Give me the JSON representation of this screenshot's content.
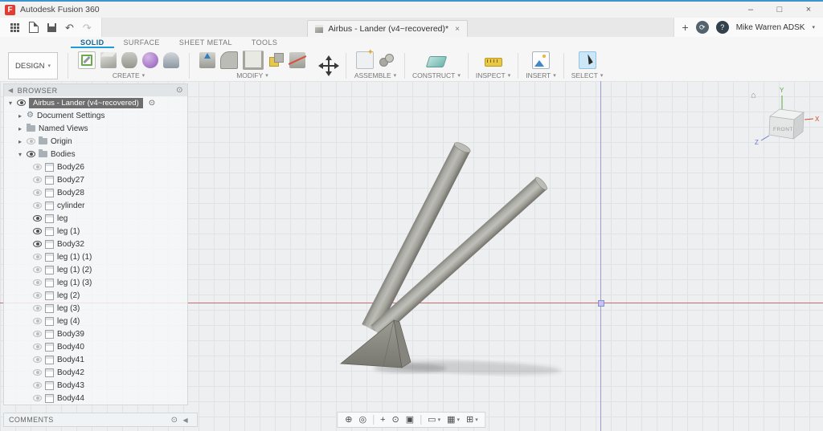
{
  "glyphs": {
    "caret_down": "▾",
    "arrow_collapsed": "▸",
    "arrow_expanded": "▾",
    "chevron_left": "◀",
    "dot_toggle": "⊙"
  },
  "titlebar": {
    "logo": "F",
    "title": "Autodesk Fusion 360",
    "minimize": "–",
    "maximize": "□",
    "close": "×"
  },
  "appbar": {
    "undo": "↶",
    "redo": "↷",
    "tab_title": "Airbus - Lander (v4~recovered)*",
    "tab_close": "×",
    "new_tab": "+",
    "status_glyph": "⟳",
    "help_glyph": "?",
    "user": "Mike Warren ADSK"
  },
  "ribbon": {
    "design": "DESIGN",
    "tabs": [
      {
        "label": "SOLID",
        "active": true
      },
      {
        "label": "SURFACE"
      },
      {
        "label": "SHEET METAL"
      },
      {
        "label": "TOOLS"
      }
    ],
    "groups": [
      "CREATE",
      "MODIFY",
      "ASSEMBLE",
      "CONSTRUCT",
      "INSPECT",
      "INSERT",
      "SELECT"
    ]
  },
  "browser": {
    "title": "BROWSER",
    "root": "Airbus - Lander (v4~recovered)",
    "folders": [
      {
        "label": "Document Settings"
      },
      {
        "label": "Named Views"
      },
      {
        "label": "Origin"
      },
      {
        "label": "Bodies"
      }
    ],
    "bodies": [
      {
        "label": "Body26",
        "visible": false
      },
      {
        "label": "Body27",
        "visible": false
      },
      {
        "label": "Body28",
        "visible": false
      },
      {
        "label": "cylinder",
        "visible": false
      },
      {
        "label": "leg",
        "visible": true
      },
      {
        "label": "leg (1)",
        "visible": true
      },
      {
        "label": "Body32",
        "visible": true
      },
      {
        "label": "leg (1) (1)",
        "visible": false
      },
      {
        "label": "leg (1) (2)",
        "visible": false
      },
      {
        "label": "leg (1) (3)",
        "visible": false
      },
      {
        "label": "leg (2)",
        "visible": false
      },
      {
        "label": "leg (3)",
        "visible": false
      },
      {
        "label": "leg (4)",
        "visible": false
      },
      {
        "label": "Body39",
        "visible": false
      },
      {
        "label": "Body40",
        "visible": false
      },
      {
        "label": "Body41",
        "visible": false
      },
      {
        "label": "Body42",
        "visible": false
      },
      {
        "label": "Body43",
        "visible": false
      },
      {
        "label": "Body44",
        "visible": false
      }
    ]
  },
  "comments": {
    "label": "COMMENTS"
  },
  "nav": {
    "icons": [
      {
        "name": "orbit",
        "glyph": "⊕"
      },
      {
        "name": "look-at",
        "glyph": "◎"
      },
      {
        "name": "pan",
        "glyph": "+"
      },
      {
        "name": "zoom",
        "glyph": "⊙"
      },
      {
        "name": "fit-view",
        "glyph": "▣"
      },
      {
        "name": "display-settings",
        "glyph": "▭",
        "caret": "▾"
      },
      {
        "name": "grid-layout",
        "glyph": "▦",
        "caret": "▾"
      },
      {
        "name": "viewports",
        "glyph": "⊞",
        "caret": "▾"
      }
    ]
  },
  "viewcube": {
    "face": "FRONT",
    "axis_x": "X",
    "axis_y": "Y",
    "axis_z": "Z",
    "home": "⌂"
  }
}
